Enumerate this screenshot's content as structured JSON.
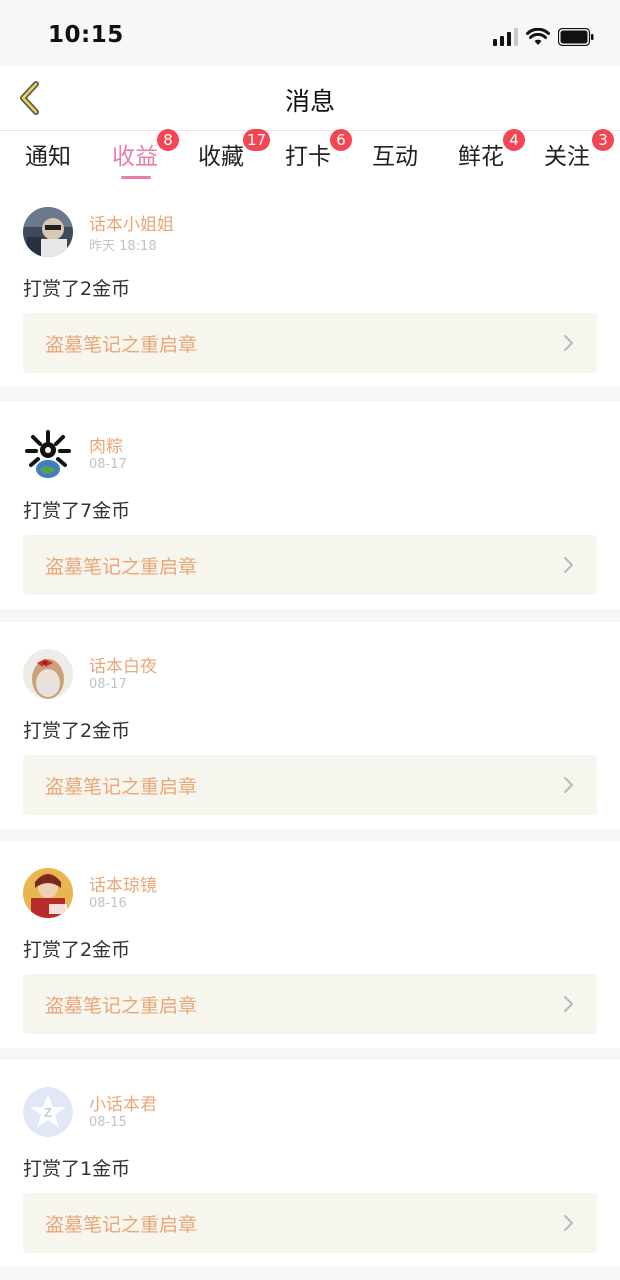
{
  "status_bar": {
    "time": "10:15"
  },
  "nav": {
    "title": "消息"
  },
  "tabs": [
    {
      "label": "通知",
      "badge": ""
    },
    {
      "label": "收益",
      "badge": "8",
      "active": true
    },
    {
      "label": "收藏",
      "badge": "17"
    },
    {
      "label": "打卡",
      "badge": "6"
    },
    {
      "label": "互动",
      "badge": ""
    },
    {
      "label": "鲜花",
      "badge": "4"
    },
    {
      "label": "关注",
      "badge": "3"
    }
  ],
  "colors": {
    "accent_pink": "#e77eae",
    "name_orange": "#eba676",
    "badge_red": "#f44553"
  },
  "messages": [
    {
      "user": "话本小姐姐",
      "time": "昨天 18:18",
      "text": "打赏了2金币",
      "chapter": "盗墓笔记之重启章",
      "avatar_icon": "photo-avatar"
    },
    {
      "user": "肉粽",
      "time": "08-17",
      "text": "打赏了7金币",
      "chapter": "盗墓笔记之重启章",
      "avatar_icon": "emblem-avatar"
    },
    {
      "user": "话本白夜",
      "time": "08-17",
      "text": "打赏了2金币",
      "chapter": "盗墓笔记之重启章",
      "avatar_icon": "photo-avatar"
    },
    {
      "user": "话本琼镜",
      "time": "08-16",
      "text": "打赏了2金币",
      "chapter": "盗墓笔记之重启章",
      "avatar_icon": "illustration-avatar"
    },
    {
      "user": "小话本君",
      "time": "08-15",
      "text": "打赏了1金币",
      "chapter": "盗墓笔记之重启章",
      "avatar_icon": "default-avatar"
    }
  ]
}
